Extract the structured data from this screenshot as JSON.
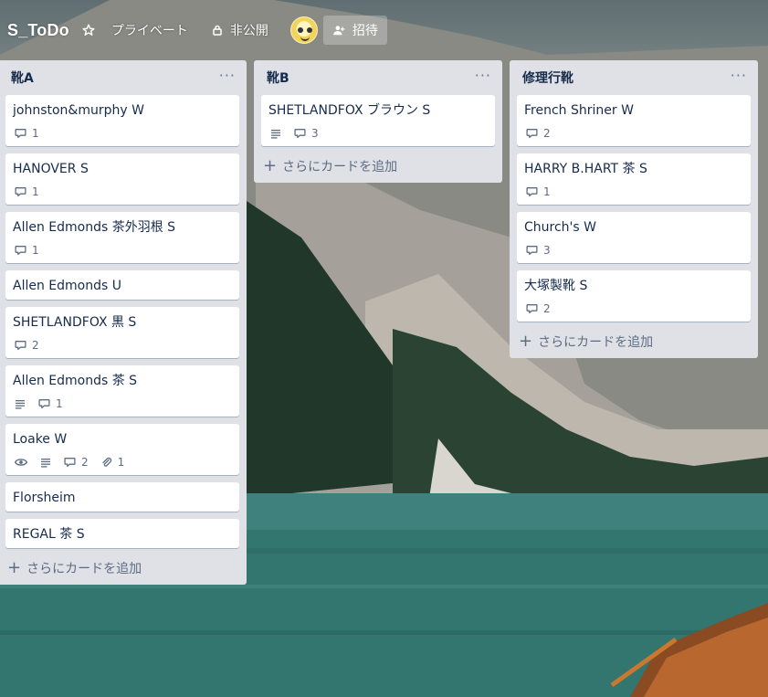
{
  "header": {
    "board_title": "S_ToDo",
    "visibility_label": "プライベート",
    "privacy_label": "非公開",
    "invite_label": "招待"
  },
  "lists": [
    {
      "title": "靴A",
      "add_card_label": "さらにカードを追加",
      "cards": [
        {
          "title": "johnston&murphy W",
          "comments": "1"
        },
        {
          "title": "HANOVER S",
          "comments": "1"
        },
        {
          "title": "Allen Edmonds 茶外羽根 S",
          "comments": "1"
        },
        {
          "title": "Allen Edmonds U"
        },
        {
          "title": "SHETLANDFOX 黒 S",
          "comments": "2"
        },
        {
          "title": "Allen Edmonds 茶 S",
          "description": true,
          "comments": "1"
        },
        {
          "title": "Loake W",
          "watching": true,
          "description": true,
          "comments": "2",
          "attachments": "1"
        },
        {
          "title": "Florsheim"
        },
        {
          "title": "REGAL 茶 S"
        }
      ]
    },
    {
      "title": "靴B",
      "add_card_label": "さらにカードを追加",
      "cards": [
        {
          "title": "SHETLANDFOX ブラウン S",
          "description": true,
          "comments": "3"
        }
      ]
    },
    {
      "title": "修理行靴",
      "add_card_label": "さらにカードを追加",
      "cards": [
        {
          "title": "French Shriner W",
          "comments": "2"
        },
        {
          "title": "HARRY B.HART 茶 S",
          "comments": "1"
        },
        {
          "title": "Church's W",
          "comments": "3"
        },
        {
          "title": "大塚製靴 S",
          "comments": "2"
        }
      ]
    }
  ],
  "icons": {
    "star": "star-icon",
    "lock": "lock-icon",
    "invite": "add-member-icon",
    "comment": "comment-icon",
    "description": "description-icon",
    "watch": "eye-icon",
    "attachment": "paperclip-icon",
    "menu": "more-icon"
  },
  "colors": {
    "list_bg": "#dfe1e6",
    "card_bg": "#ffffff",
    "text": "#172b4d",
    "muted": "#5e6c84"
  }
}
